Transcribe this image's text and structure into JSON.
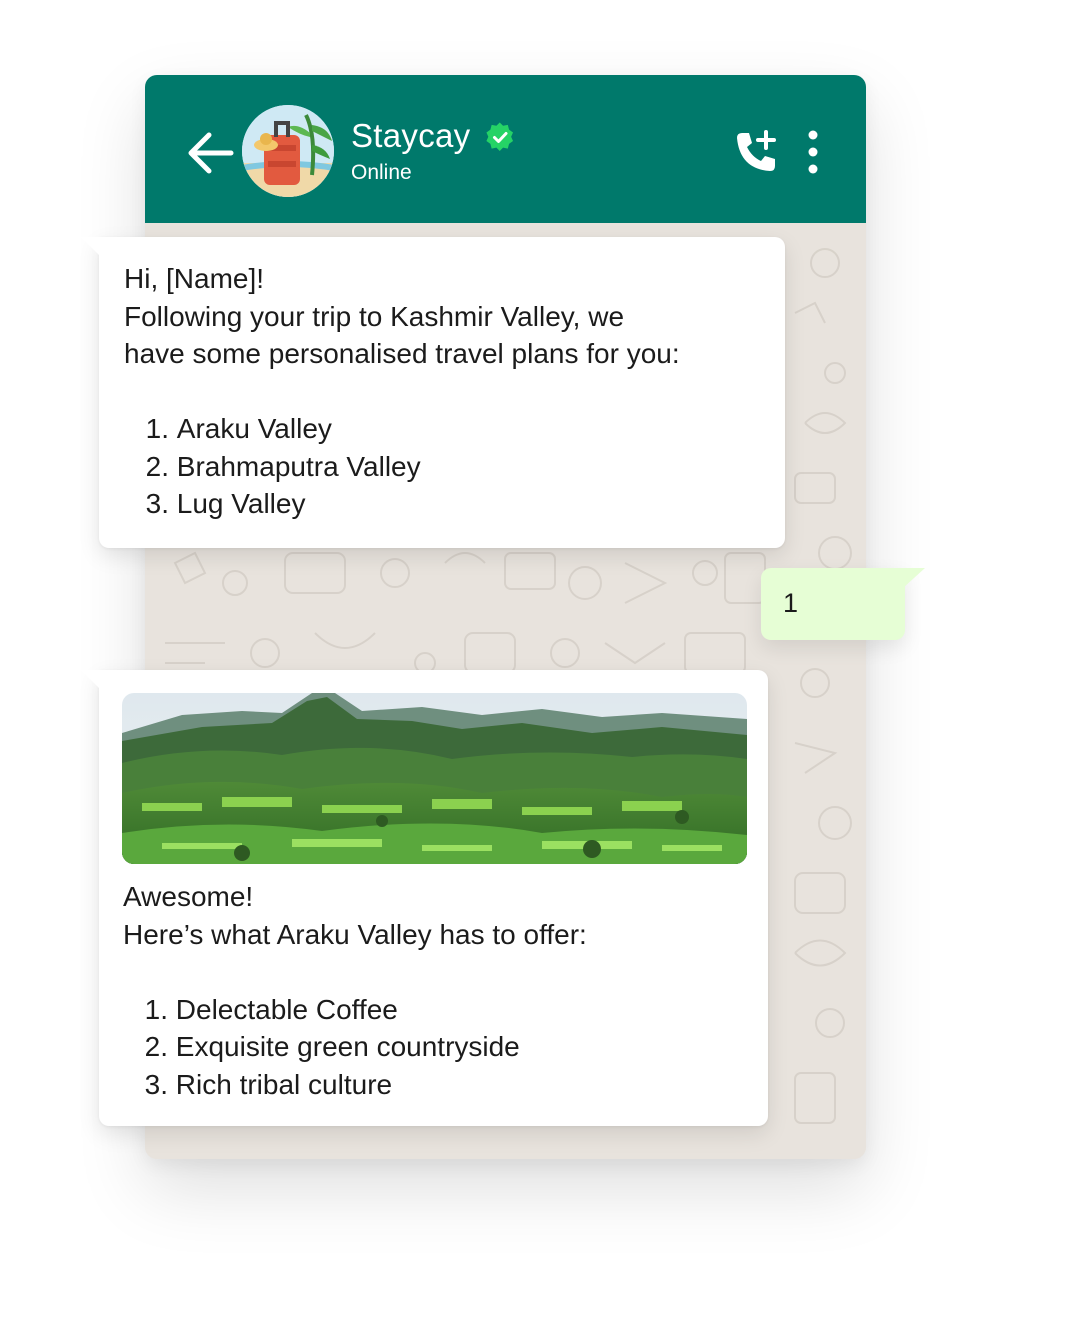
{
  "header": {
    "contact_name": "Staycay",
    "status": "Online",
    "icons": [
      "back-arrow-icon",
      "avatar",
      "verified-icon",
      "add-call-icon",
      "more-vert-icon"
    ],
    "color": "#00796b"
  },
  "messages": [
    {
      "from": "business",
      "lines": [
        "Hi, [Name]!",
        "Following your trip to Kashmir Valley, we",
        "have some personalised travel plans for you:"
      ],
      "list": [
        {
          "num": "1.",
          "text": "Araku Valley"
        },
        {
          "num": "2.",
          "text": "Brahmaputra Valley"
        },
        {
          "num": "3.",
          "text": "Lug Valley"
        }
      ]
    },
    {
      "from": "user",
      "text": "1",
      "color": "#e6fed5"
    },
    {
      "from": "business",
      "image": "green-valley-landscape",
      "lines": [
        "Awesome!",
        "Here’s what Araku Valley has to offer:"
      ],
      "list": [
        {
          "num": "1.",
          "text": "Delectable Coffee"
        },
        {
          "num": "2.",
          "text": "Exquisite green countryside"
        },
        {
          "num": "3.",
          "text": "Rich tribal culture"
        }
      ]
    }
  ]
}
